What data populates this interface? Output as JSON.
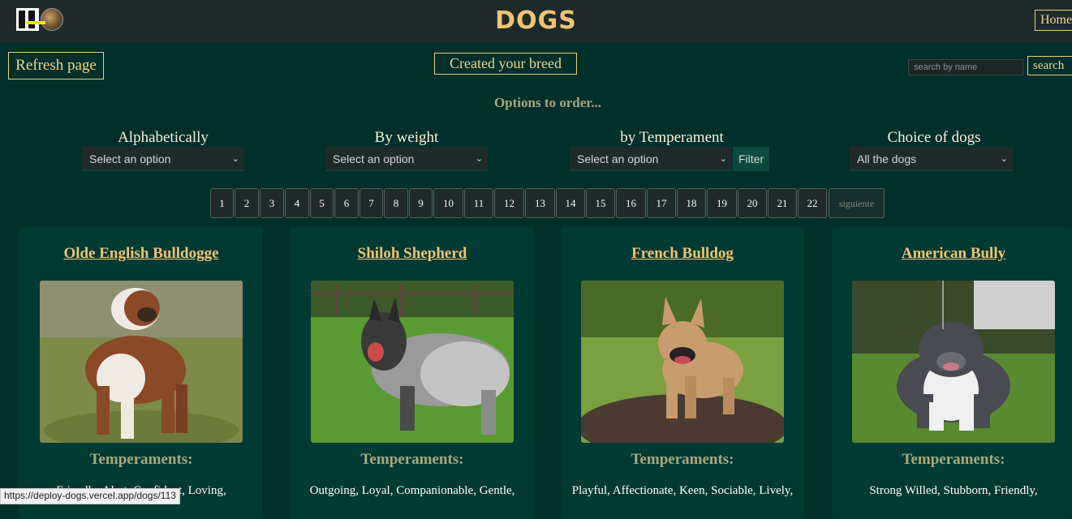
{
  "header": {
    "title": "DOGS",
    "home_label": "Home"
  },
  "toolbar": {
    "refresh_label": "Refresh page",
    "create_label": "Created your breed",
    "search_placeholder": "search by name",
    "search_label": "search"
  },
  "options": {
    "title": "Options to order...",
    "groups": [
      {
        "label": "Alphabetically",
        "selected": "Select an option"
      },
      {
        "label": "By weight",
        "selected": "Select an option"
      },
      {
        "label": "by Temperament",
        "selected": "Select an option"
      },
      {
        "label": "Choice of dogs",
        "selected": "All the dogs"
      }
    ],
    "filter_label": "Filter"
  },
  "pagination": {
    "pages": [
      "1",
      "2",
      "3",
      "4",
      "5",
      "6",
      "7",
      "8",
      "9",
      "10",
      "11",
      "12",
      "13",
      "14",
      "15",
      "16",
      "17",
      "18",
      "19",
      "20",
      "21",
      "22"
    ],
    "next_label": "siguiente"
  },
  "cards": [
    {
      "name": "Olde English Bulldogge",
      "temperament_title": "Temperaments:",
      "temperaments": "Friendly, Alert, Confident, Loving,"
    },
    {
      "name": "Shiloh Shepherd",
      "temperament_title": "Temperaments:",
      "temperaments": "Outgoing, Loyal, Companionable, Gentle,"
    },
    {
      "name": "French Bulldog",
      "temperament_title": "Temperaments:",
      "temperaments": "Playful, Affectionate, Keen, Sociable, Lively,"
    },
    {
      "name": "American Bully",
      "temperament_title": "Temperaments:",
      "temperaments": "Strong Willed, Stubborn, Friendly,"
    }
  ],
  "status_bar": {
    "url": "https://deploy-dogs.vercel.app/dogs/113"
  }
}
